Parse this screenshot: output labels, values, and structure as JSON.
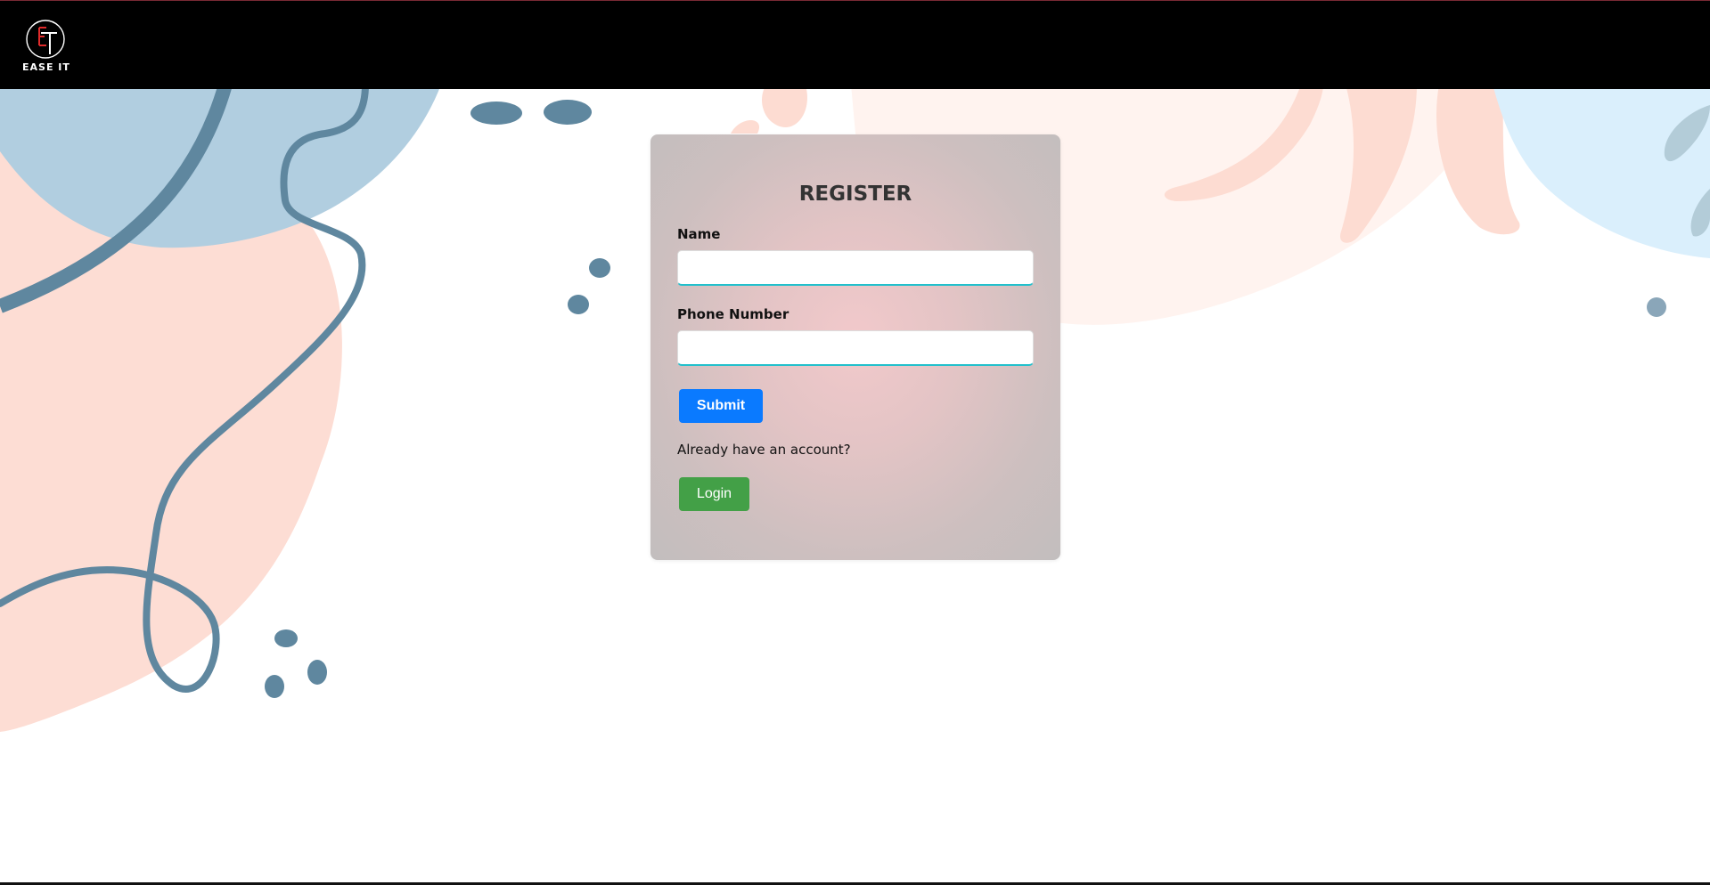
{
  "header": {
    "brand_name": "EASE IT",
    "background_color": "#000000",
    "logo_icon": "ease-it-logo-icon"
  },
  "register_form": {
    "title": "REGISTER",
    "name_label": "Name",
    "name_value": "",
    "phone_label": "Phone Number",
    "phone_value": "",
    "submit_label": "Submit",
    "already_account_text": "Already have an account?",
    "login_label": "Login"
  },
  "colors": {
    "submit_button": "#0a7aff",
    "login_button": "#43a047",
    "input_focus_border": "#22c0cc",
    "decor_blue": "#5f879f",
    "decor_pink": "#fdddd4",
    "decor_light_blue": "#b1cee0"
  }
}
